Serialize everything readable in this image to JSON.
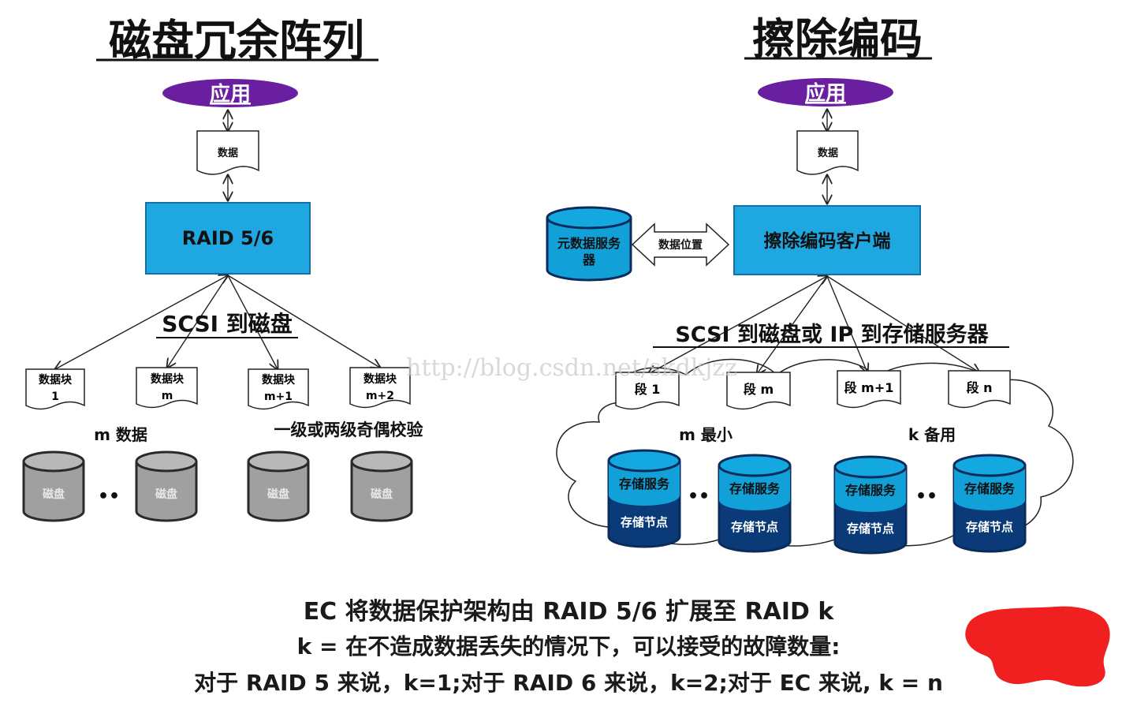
{
  "left": {
    "title": "磁盘冗余阵列",
    "app": "应用",
    "data": "数据",
    "raid": "RAID 5/6",
    "scsi": "SCSI 到磁盘",
    "blocks": [
      {
        "line1": "数据块",
        "line2": "1"
      },
      {
        "line1": "数据块",
        "line2": "m"
      },
      {
        "line1": "数据块",
        "line2": "m+1"
      },
      {
        "line1": "数据块",
        "line2": "m+2"
      }
    ],
    "m_data": "m 数据",
    "parity": "一级或两级奇偶校验",
    "disk": "磁盘",
    "dots": "••"
  },
  "right": {
    "title": "擦除编码",
    "app": "应用",
    "data": "数据",
    "meta_line1": "元数据服务",
    "meta_line2": "器",
    "data_location": "数据位置",
    "client": "擦除编码客户端",
    "scsi": "SCSI 到磁盘或 IP 到存储服务器",
    "segments": [
      "段 1",
      "段 m",
      "段 m+1",
      "段 n"
    ],
    "m_min": "m 最小",
    "k_backup": "k 备用",
    "storage_service": "存储服务",
    "storage_node": "存储节点",
    "dots": "••"
  },
  "watermark": "http://blog.csdn.net/skdkjzz",
  "caption": {
    "line1": "EC 将数据保护架构由 RAID 5/6 扩展至 RAID k",
    "line2": "k = 在不造成数据丢失的情况下，可以接受的故障数量:",
    "line3": "对于 RAID 5 来说，k=1;对于 RAID 6 来说，k=2;对于 EC 来说, k = n"
  },
  "colors": {
    "ellipse": "#6a1fa0",
    "box": "#1ea7e1",
    "cylinder_gray": "#a0a0a0",
    "cylinder_blue": "#11a0d8",
    "cylinder_navy": "#0a3a78",
    "scribble": "#f02020"
  }
}
